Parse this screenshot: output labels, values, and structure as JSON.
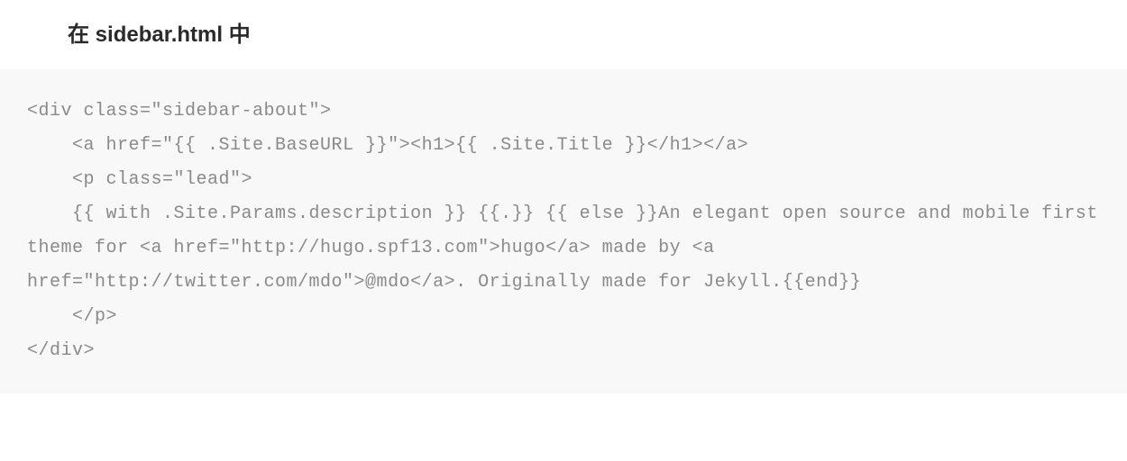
{
  "heading": {
    "prefix": "在 ",
    "filename": "sidebar.html",
    "suffix": " 中"
  },
  "code": "<div class=\"sidebar-about\">\n    <a href=\"{{ .Site.BaseURL }}\"><h1>{{ .Site.Title }}</h1></a>\n    <p class=\"lead\">\n    {{ with .Site.Params.description }} {{.}} {{ else }}An elegant open source and mobile first theme for <a href=\"http://hugo.spf13.com\">hugo</a> made by <a href=\"http://twitter.com/mdo\">@mdo</a>. Originally made for Jekyll.{{end}}\n    </p>\n</div>"
}
